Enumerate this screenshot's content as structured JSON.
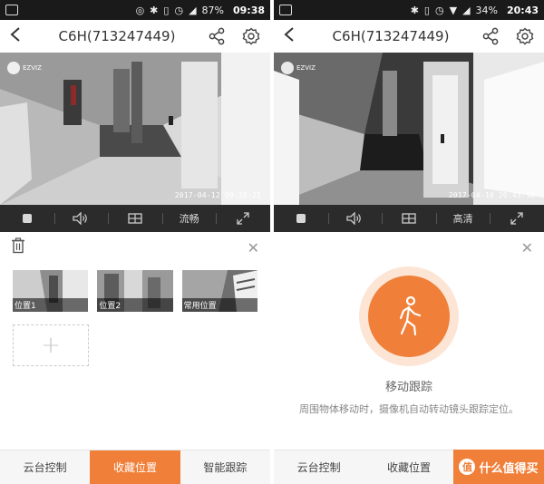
{
  "left": {
    "status": {
      "battery": "87%",
      "time": "09:38"
    },
    "title": "C6H(713247449)",
    "video": {
      "timestamp": "2017-04-12 09:38:21"
    },
    "controls": {
      "quality": "流畅"
    },
    "presets": [
      {
        "label": "位置1"
      },
      {
        "label": "位置2"
      },
      {
        "label": "常用位置"
      }
    ],
    "tabs": [
      "云台控制",
      "收藏位置",
      "智能跟踪"
    ]
  },
  "right": {
    "status": {
      "battery": "34%",
      "time": "20:43"
    },
    "title": "C6H(713247449)",
    "video": {
      "timestamp": "2017-04-10 20:43:38"
    },
    "controls": {
      "quality": "高清"
    },
    "tracking": {
      "title": "移动跟踪",
      "description": "周围物体移动时，摄像机自动转动镜头跟踪定位。"
    },
    "tabs": [
      "云台控制",
      "收藏位置"
    ],
    "watermark": {
      "badge": "值",
      "text": "什么值得买"
    }
  },
  "colors": {
    "accent": "#f07f39",
    "accent_light": "#fde5d6",
    "control_bar": "#2b2b2b"
  },
  "icons": [
    "back-arrow-icon",
    "share-icon",
    "settings-gear-icon",
    "stop-icon",
    "volume-icon",
    "split-screen-icon",
    "fullscreen-icon",
    "trash-icon",
    "close-icon",
    "add-icon",
    "walking-person-icon"
  ]
}
